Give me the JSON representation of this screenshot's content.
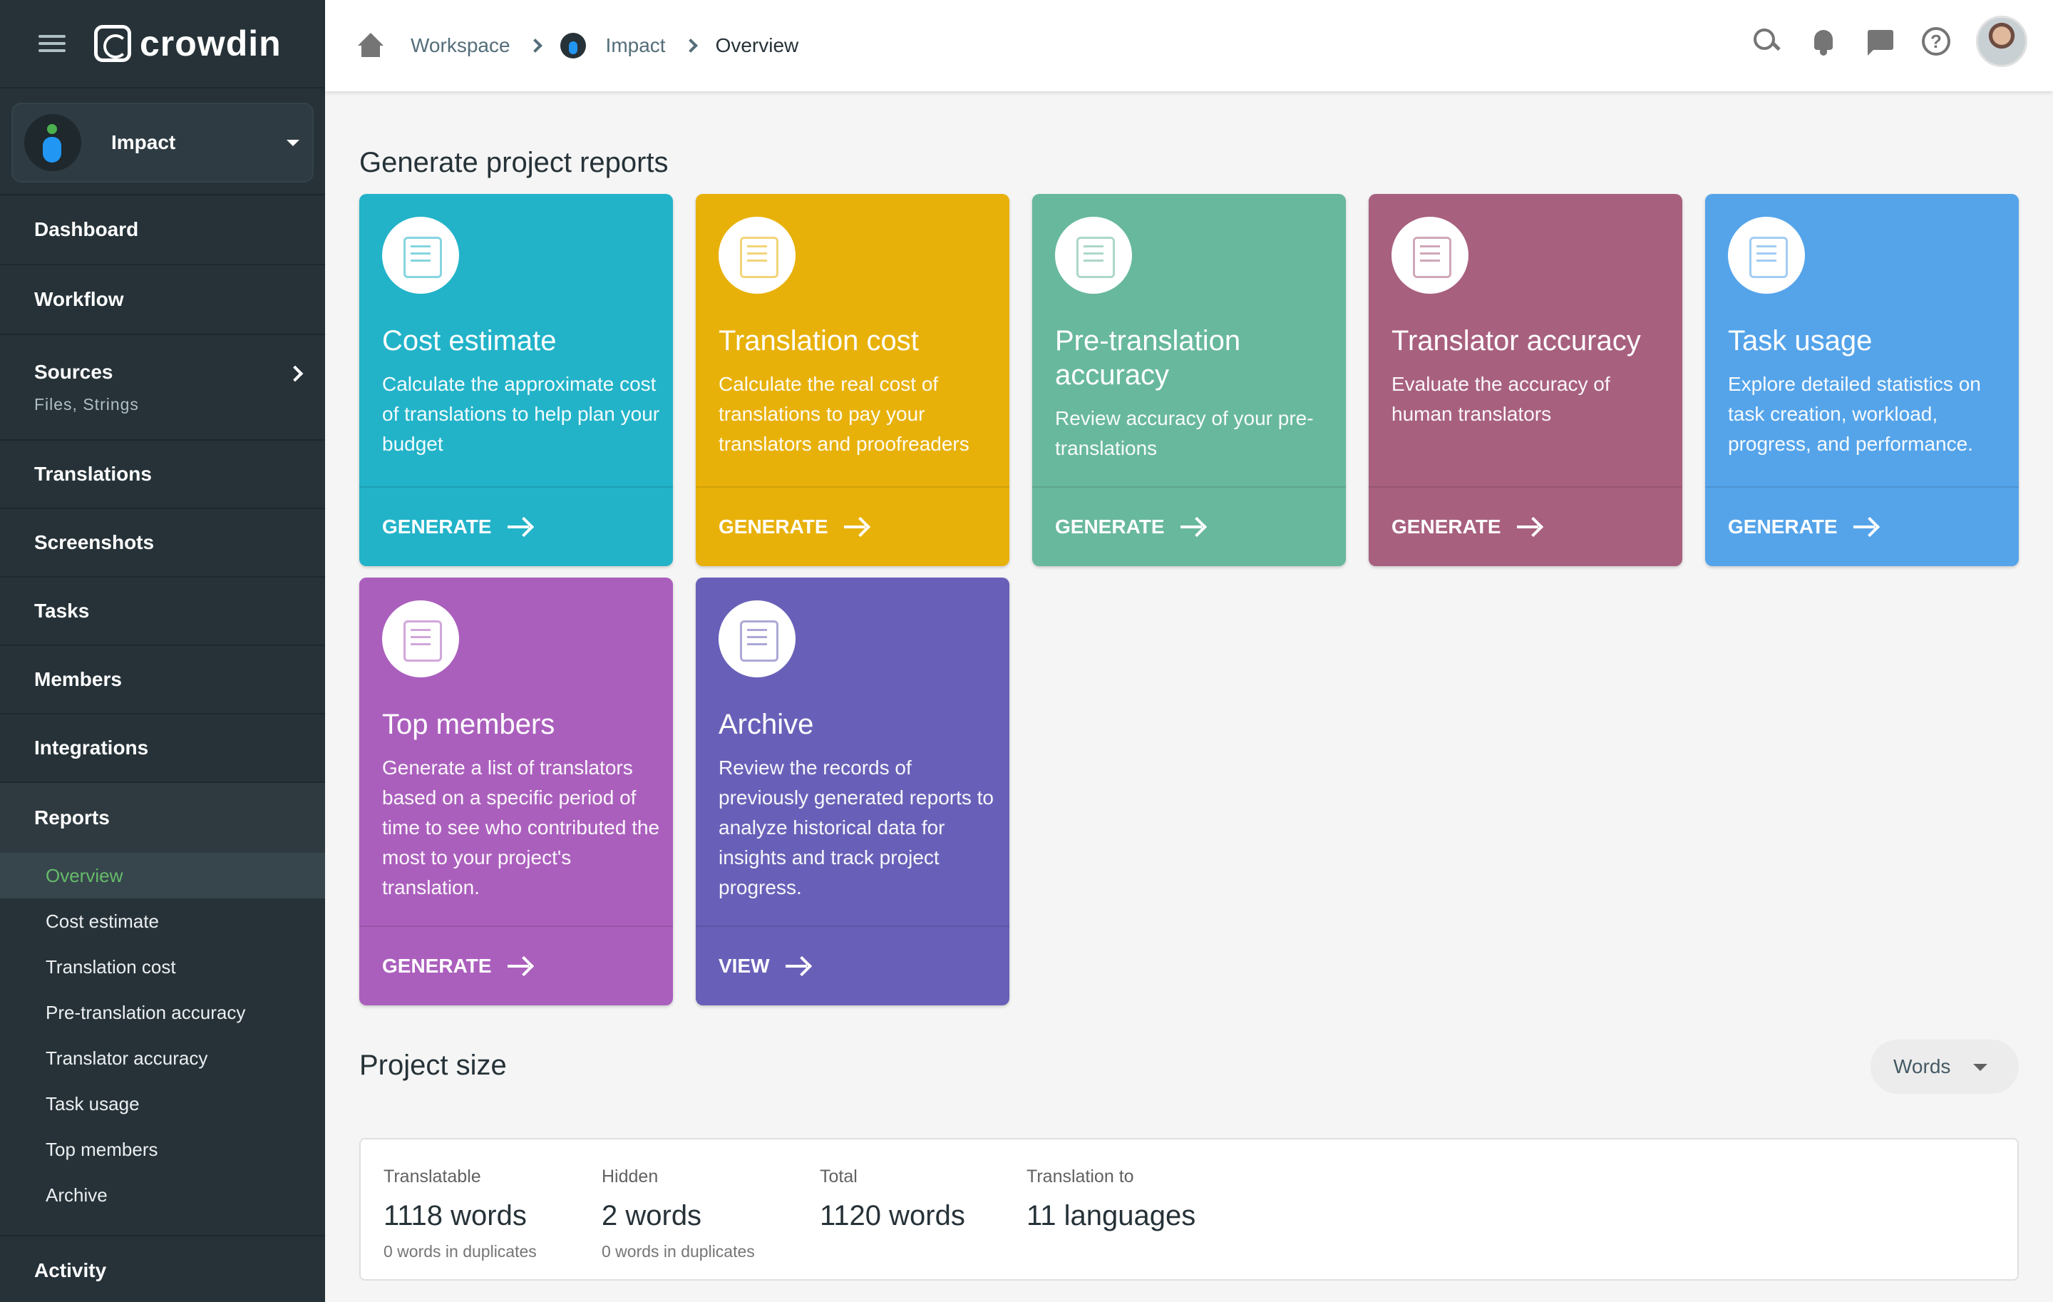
{
  "sidebar": {
    "logo": "crowdin",
    "project": "Impact",
    "nav": {
      "dashboard": "Dashboard",
      "workflow": "Workflow",
      "sources": "Sources",
      "sources_sub": "Files, Strings",
      "translations": "Translations",
      "screenshots": "Screenshots",
      "tasks": "Tasks",
      "members": "Members",
      "integrations": "Integrations",
      "reports": "Reports",
      "activity": "Activity"
    },
    "reports_sub": [
      "Overview",
      "Cost estimate",
      "Translation cost",
      "Pre-translation accuracy",
      "Translator accuracy",
      "Task usage",
      "Top members",
      "Archive"
    ]
  },
  "header": {
    "breadcrumb": [
      "Workspace",
      "Impact",
      "Overview"
    ]
  },
  "main": {
    "reports_title": "Generate project reports",
    "cards": [
      {
        "title": "Cost estimate",
        "desc": "Calculate the approximate cost of translations to help plan your budget",
        "action": "GENERATE",
        "color": "#22b3c9"
      },
      {
        "title": "Translation cost",
        "desc": "Calculate the real cost of translations to pay your translators and proofreaders",
        "action": "GENERATE",
        "color": "#e8b10a"
      },
      {
        "title": "Pre-translation accuracy",
        "desc": "Review accuracy of your pre-translations",
        "action": "GENERATE",
        "color": "#68b89d"
      },
      {
        "title": "Translator accuracy",
        "desc": "Evaluate the accuracy of human translators",
        "action": "GENERATE",
        "color": "#a8607f"
      },
      {
        "title": "Task usage",
        "desc": "Explore detailed statistics on task creation, workload, progress, and performance.",
        "action": "GENERATE",
        "color": "#55a4ea"
      },
      {
        "title": "Top members",
        "desc": "Generate a list of translators based on a specific period of time to see who contributed the most to your project's translation.",
        "action": "GENERATE",
        "color": "#ab5fbd"
      },
      {
        "title": "Archive",
        "desc": "Review the records of previously generated reports to analyze historical data for insights and track project progress.",
        "action": "VIEW",
        "color": "#6860b8"
      }
    ],
    "size_title": "Project size",
    "unit_select": "Words",
    "stats": [
      {
        "label": "Translatable",
        "value": "1118 words",
        "note": "0 words in duplicates"
      },
      {
        "label": "Hidden",
        "value": "2 words",
        "note": "0 words in duplicates"
      },
      {
        "label": "Total",
        "value": "1120 words",
        "note": ""
      },
      {
        "label": "Translation to",
        "value": "11 languages",
        "note": ""
      }
    ]
  }
}
